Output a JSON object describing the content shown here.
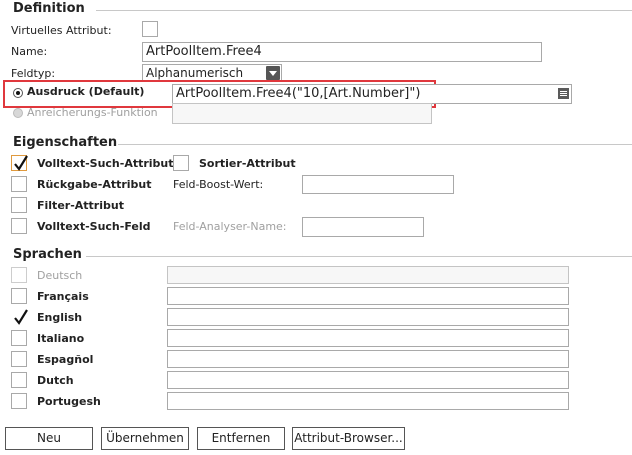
{
  "definition": {
    "title": "Definition",
    "virtual_label": "Virtuelles Attribut:",
    "name_label": "Name:",
    "name_value": "ArtPoolItem.Free4",
    "type_label": "Feldtyp:",
    "type_value": "Alphanumerisch",
    "expression_label": "Ausdruck (Default)",
    "expression_value": "ArtPoolItem.Free4(\"10,[Art.Number]\")",
    "enrichment_label": "Anreicherungs-Funktion",
    "enrichment_value": ""
  },
  "properties": {
    "title": "Eigenschaften",
    "fulltext_attr": "Volltext-Such-Attribut",
    "sort_attr": "Sortier-Attribut",
    "return_attr": "Rückgabe-Attribut",
    "boost_label": "Feld-Boost-Wert:",
    "boost_value": "",
    "filter_attr": "Filter-Attribut",
    "fulltext_field": "Volltext-Such-Feld",
    "analyser_label": "Feld-Analyser-Name:",
    "analyser_value": ""
  },
  "languages": {
    "title": "Sprachen",
    "items": [
      {
        "label": "Deutsch",
        "value": ""
      },
      {
        "label": "Français",
        "value": ""
      },
      {
        "label": "English",
        "value": ""
      },
      {
        "label": "Italiano",
        "value": ""
      },
      {
        "label": "Espagñol",
        "value": ""
      },
      {
        "label": "Dutch",
        "value": ""
      },
      {
        "label": "Portugesh",
        "value": ""
      }
    ]
  },
  "buttons": {
    "new": "Neu",
    "apply": "Übernehmen",
    "remove": "Entfernen",
    "browser": "Attribut-Browser..."
  },
  "colors": {
    "highlight": "#e0383d",
    "focus_border": "#e09a3e"
  },
  "icons": {
    "check": "checkmark-icon",
    "dropdown": "chevron-down-icon",
    "menu": "menu-icon"
  }
}
